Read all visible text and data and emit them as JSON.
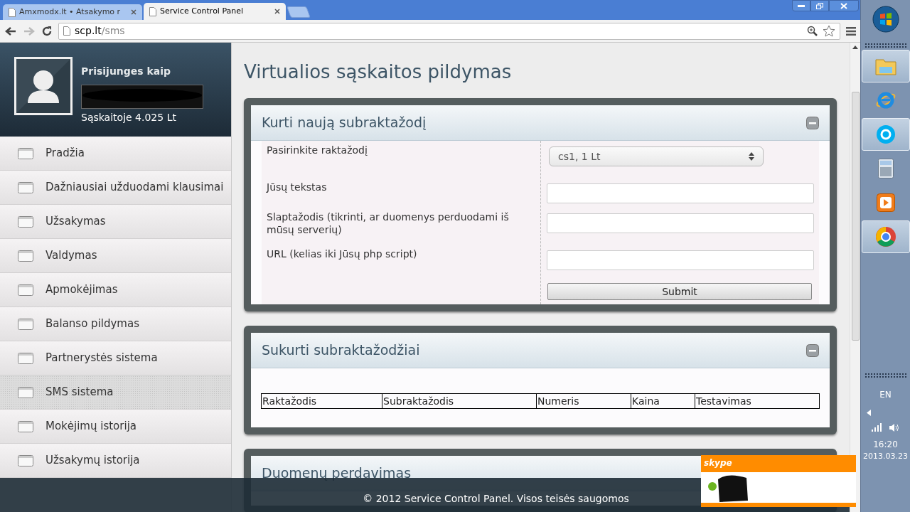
{
  "browser": {
    "tabs": [
      {
        "title": "Amxmodx.lt • Atsakymo r",
        "selected": false
      },
      {
        "title": "Service Control Panel",
        "selected": true
      }
    ],
    "url": {
      "host": "scp.lt",
      "path": "/sms"
    }
  },
  "sidebar": {
    "user": {
      "label": "Prisijunges kaip",
      "balance": "Sąskaitoje 4.025 Lt"
    },
    "menu": [
      {
        "label": "Pradžia",
        "selected": false
      },
      {
        "label": "Dažniausiai užduodami klausimai",
        "selected": false
      },
      {
        "label": "Užsakymas",
        "selected": false
      },
      {
        "label": "Valdymas",
        "selected": false
      },
      {
        "label": "Apmokėjimas",
        "selected": false
      },
      {
        "label": "Balanso pildymas",
        "selected": false
      },
      {
        "label": "Partnerystės sistema",
        "selected": false
      },
      {
        "label": "SMS sistema",
        "selected": true
      },
      {
        "label": "Mokėjimų istorija",
        "selected": false
      },
      {
        "label": "Užsakymų istorija",
        "selected": false
      }
    ]
  },
  "content": {
    "title": "Virtualios sąskaitos pildymas",
    "panels": [
      {
        "kind": "form",
        "title": "Kurti naują subraktažodį",
        "fields": [
          {
            "kind": "select",
            "label": "Pasirinkite raktažodį",
            "value": "cs1, 1 Lt"
          },
          {
            "kind": "text",
            "label": "Jūsų tekstas"
          },
          {
            "kind": "text",
            "label": "Slaptažodis (tikrinti, ar duomenys perduodami iš mūsų serverių)"
          },
          {
            "kind": "text",
            "label": "URL (kelias iki Jūsų php script)"
          }
        ],
        "submit": "Submit"
      },
      {
        "kind": "table",
        "title": "Sukurti subraktažodžiai",
        "columns": [
          "Raktažodis",
          "Subraktažodis",
          "Numeris",
          "Kaina",
          "Testavimas"
        ]
      },
      {
        "kind": "collapsed",
        "title": "Duomenų perdavimas"
      }
    ]
  },
  "footer": "© 2012 Service Control Panel. Visos teisės saugomos",
  "taskbar": {
    "apps": [
      {
        "kind": "explorer",
        "running": true
      },
      {
        "kind": "ie",
        "running": false
      },
      {
        "kind": "skype",
        "running": true
      },
      {
        "kind": "calculator",
        "running": false
      },
      {
        "kind": "media",
        "running": false
      },
      {
        "kind": "chrome",
        "running": true
      }
    ],
    "language": "EN",
    "time": "16:20",
    "date": "2013.03.23"
  },
  "skype_popup": {
    "logo": "skype"
  }
}
